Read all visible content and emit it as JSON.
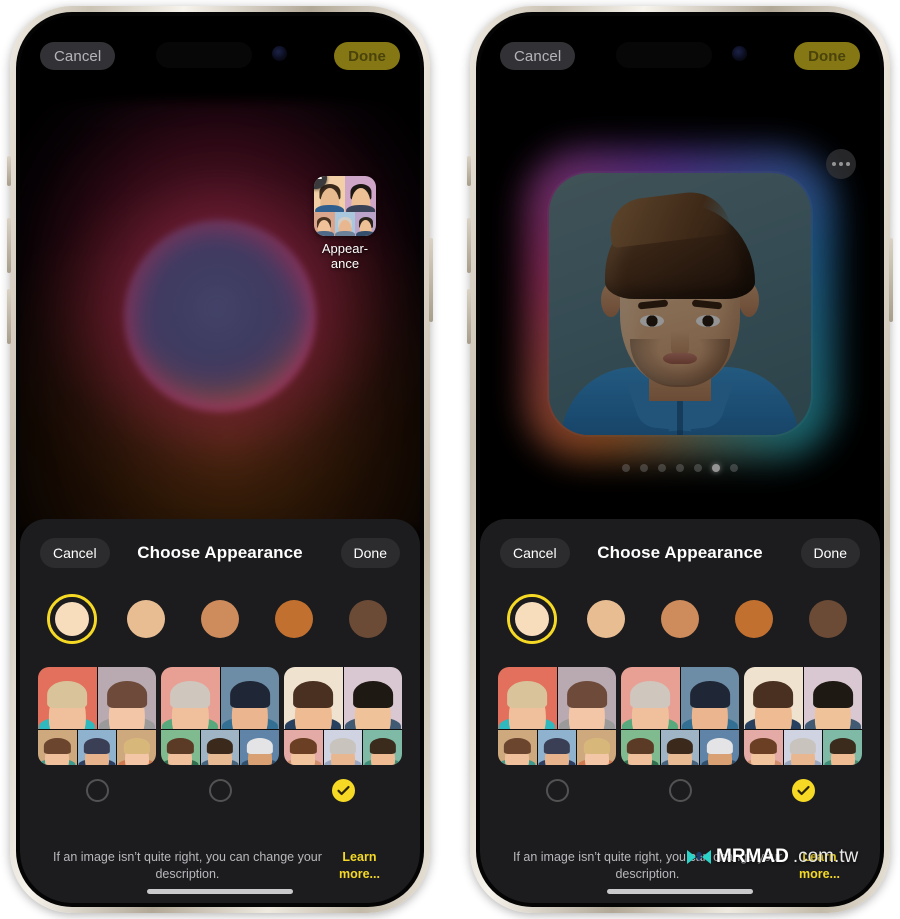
{
  "page": {
    "watermark_brand": "MRMAD",
    "watermark_suffix": ".com.tw"
  },
  "phones": [
    {
      "id": "left",
      "topbar": {
        "cancel_label": "Cancel",
        "done_label": "Done"
      },
      "canvas": {
        "kind": "orb-placeholder",
        "chip": {
          "label": "Appear-\nance",
          "label_line1": "Appear-",
          "label_line2": "ance",
          "remove_badge": "minus-icon"
        }
      },
      "sheet": {
        "cancel_label": "Cancel",
        "title": "Choose Appearance",
        "done_label": "Done",
        "footer_text": "If an image isn’t quite right, you can change your description. ",
        "footer_link": "Learn more..."
      }
    },
    {
      "id": "right",
      "topbar": {
        "cancel_label": "Cancel",
        "done_label": "Done"
      },
      "canvas": {
        "kind": "generated-portrait",
        "more_button": "ellipsis-icon",
        "page_dots_total": 7,
        "page_dots_active_index": 5
      },
      "sheet": {
        "cancel_label": "Cancel",
        "title": "Choose Appearance",
        "done_label": "Done",
        "footer_text": "If an image isn’t quite right, you can change your description. ",
        "footer_link": "Learn more..."
      }
    }
  ],
  "skin_tones": {
    "selected_index": 1,
    "selected_ring_color": "#F5D924",
    "swatches": [
      {
        "name": "tone-1",
        "color": "#F8DDBC"
      },
      {
        "name": "tone-2",
        "color": "#E8BD92"
      },
      {
        "name": "tone-3",
        "color": "#CE8B5B"
      },
      {
        "name": "tone-4",
        "color": "#C1702F"
      },
      {
        "name": "tone-5",
        "color": "#6B4A36"
      }
    ]
  },
  "style_cards": {
    "selected_index": 2,
    "check_color": "#F5D924",
    "cards": [
      {
        "name": "style-card-1",
        "tiles": [
          {
            "bg": "#e2705c",
            "hair": "#d9c39a",
            "skin": "#f0c09c",
            "body": "#2fb8bd"
          },
          {
            "bg": "#b9aab2",
            "hair": "#6d4a3a",
            "skin": "#f2c6a6",
            "body": "#9a9a9a"
          },
          {
            "bg": "#cfa97e",
            "hair": "#6b452e",
            "skin": "#f0c09c",
            "body": "#3f9a8e"
          },
          {
            "bg": "#8fb2cf",
            "hair": "#3a3f55",
            "skin": "#e7b38c",
            "body": "#2c3f63"
          },
          {
            "bg": "#cfa97e",
            "hair": "#d8b87a",
            "skin": "#f2c6a6",
            "body": "#d0784f"
          }
        ]
      },
      {
        "name": "style-card-2",
        "tiles": [
          {
            "bg": "#e8a094",
            "hair": "#cfc6bd",
            "skin": "#f0c09c",
            "body": "#57a87c"
          },
          {
            "bg": "#6d8ca5",
            "hair": "#1f2736",
            "skin": "#ebb68f",
            "body": "#336f93"
          },
          {
            "bg": "#7fbb8e",
            "hair": "#5b3a26",
            "skin": "#f0c09c",
            "body": "#2f6f4f"
          },
          {
            "bg": "#9fb4c4",
            "hair": "#3b2a1c",
            "skin": "#e9bb94",
            "body": "#46637e"
          },
          {
            "bg": "#5f84a8",
            "hair": "#e4e4e6",
            "skin": "#d9a173",
            "body": "#2f4f6d"
          }
        ]
      },
      {
        "name": "style-card-3",
        "tiles": [
          {
            "bg": "#efe3cf",
            "hair": "#4a3020",
            "skin": "#eebb92",
            "body": "#27405f"
          },
          {
            "bg": "#d9c8d2",
            "hair": "#1f1913",
            "skin": "#efc29a",
            "body": "#3f5a72"
          },
          {
            "bg": "#e4aaa6",
            "hair": "#6b3f24",
            "skin": "#f1c49e",
            "body": "#cf8f6e"
          },
          {
            "bg": "#cfd3e2",
            "hair": "#c8c4bd",
            "skin": "#e9b78f",
            "body": "#9aa7c0"
          },
          {
            "bg": "#7fbaa6",
            "hair": "#3b2b1d",
            "skin": "#eebb92",
            "body": "#3f8f7a"
          }
        ]
      }
    ]
  },
  "chip_tiles": [
    {
      "bg": "#f2cfa6",
      "hair": "#3a2a1c",
      "skin": "#e7b98f",
      "body": "#2f5f8f"
    },
    {
      "bg": "#cfa5c8",
      "hair": "#1d1713",
      "skin": "#edc096",
      "body": "#3a4258"
    },
    {
      "bg": "#d9a58d",
      "hair": "#4a3220",
      "skin": "#efc29a",
      "body": "#4f6a88"
    },
    {
      "bg": "#a9c7dd",
      "hair": "#d2cdc6",
      "skin": "#e9b78f",
      "body": "#6c829b"
    },
    {
      "bg": "#bba3c9",
      "hair": "#2a2119",
      "skin": "#edc096",
      "body": "#35506e"
    }
  ]
}
